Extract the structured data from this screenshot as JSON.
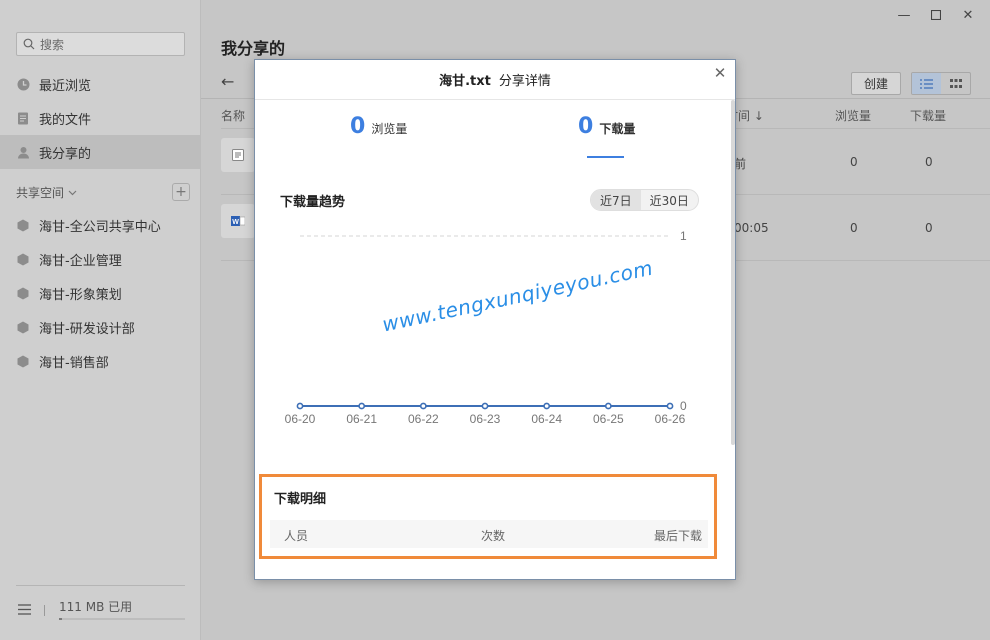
{
  "sidebar": {
    "search_placeholder": "搜索",
    "nav": [
      {
        "label": "最近浏览",
        "icon": "clock-icon"
      },
      {
        "label": "我的文件",
        "icon": "file-icon"
      },
      {
        "label": "我分享的",
        "icon": "person-icon",
        "active": true
      }
    ],
    "section_title": "共享空间",
    "spaces": [
      {
        "label": "海甘-全公司共享中心"
      },
      {
        "label": "海甘-企业管理"
      },
      {
        "label": "海甘-形象策划"
      },
      {
        "label": "海甘-研发设计部"
      },
      {
        "label": "海甘-销售部"
      }
    ],
    "storage_used": "111 MB 已用",
    "storage_fraction": 0.02
  },
  "main": {
    "title": "我分享的",
    "create_label": "创建",
    "columns": {
      "name": "名称",
      "time": "时间 ↓",
      "views": "浏览量",
      "downloads": "下载量"
    },
    "rows": [
      {
        "time": "前",
        "views": "0",
        "downloads": "0",
        "icon": "text-file-icon"
      },
      {
        "time": "00:05",
        "views": "0",
        "downloads": "0",
        "icon": "word-file-icon"
      }
    ]
  },
  "modal": {
    "filename": "海甘.txt",
    "title": "分享详情",
    "views_count": "0",
    "views_label": "浏览量",
    "downloads_count": "0",
    "downloads_label": "下载量",
    "trend_title": "下载量趋势",
    "range_7": "近7日",
    "range_30": "近30日",
    "detail_title": "下载明细",
    "detail_cols": {
      "person": "人员",
      "count": "次数",
      "last": "最后下载"
    }
  },
  "chart_data": {
    "type": "line",
    "title": "下载量趋势",
    "x": [
      "06-20",
      "06-21",
      "06-22",
      "06-23",
      "06-24",
      "06-25",
      "06-26"
    ],
    "series": [
      {
        "values": [
          0,
          0,
          0,
          0,
          0,
          0,
          0
        ]
      }
    ],
    "ylim": [
      0,
      1
    ],
    "yticks": [
      "1",
      "0"
    ],
    "grid": true,
    "color": "#3d6fb6"
  },
  "watermark": "www.tengxunqiyeyou.com"
}
